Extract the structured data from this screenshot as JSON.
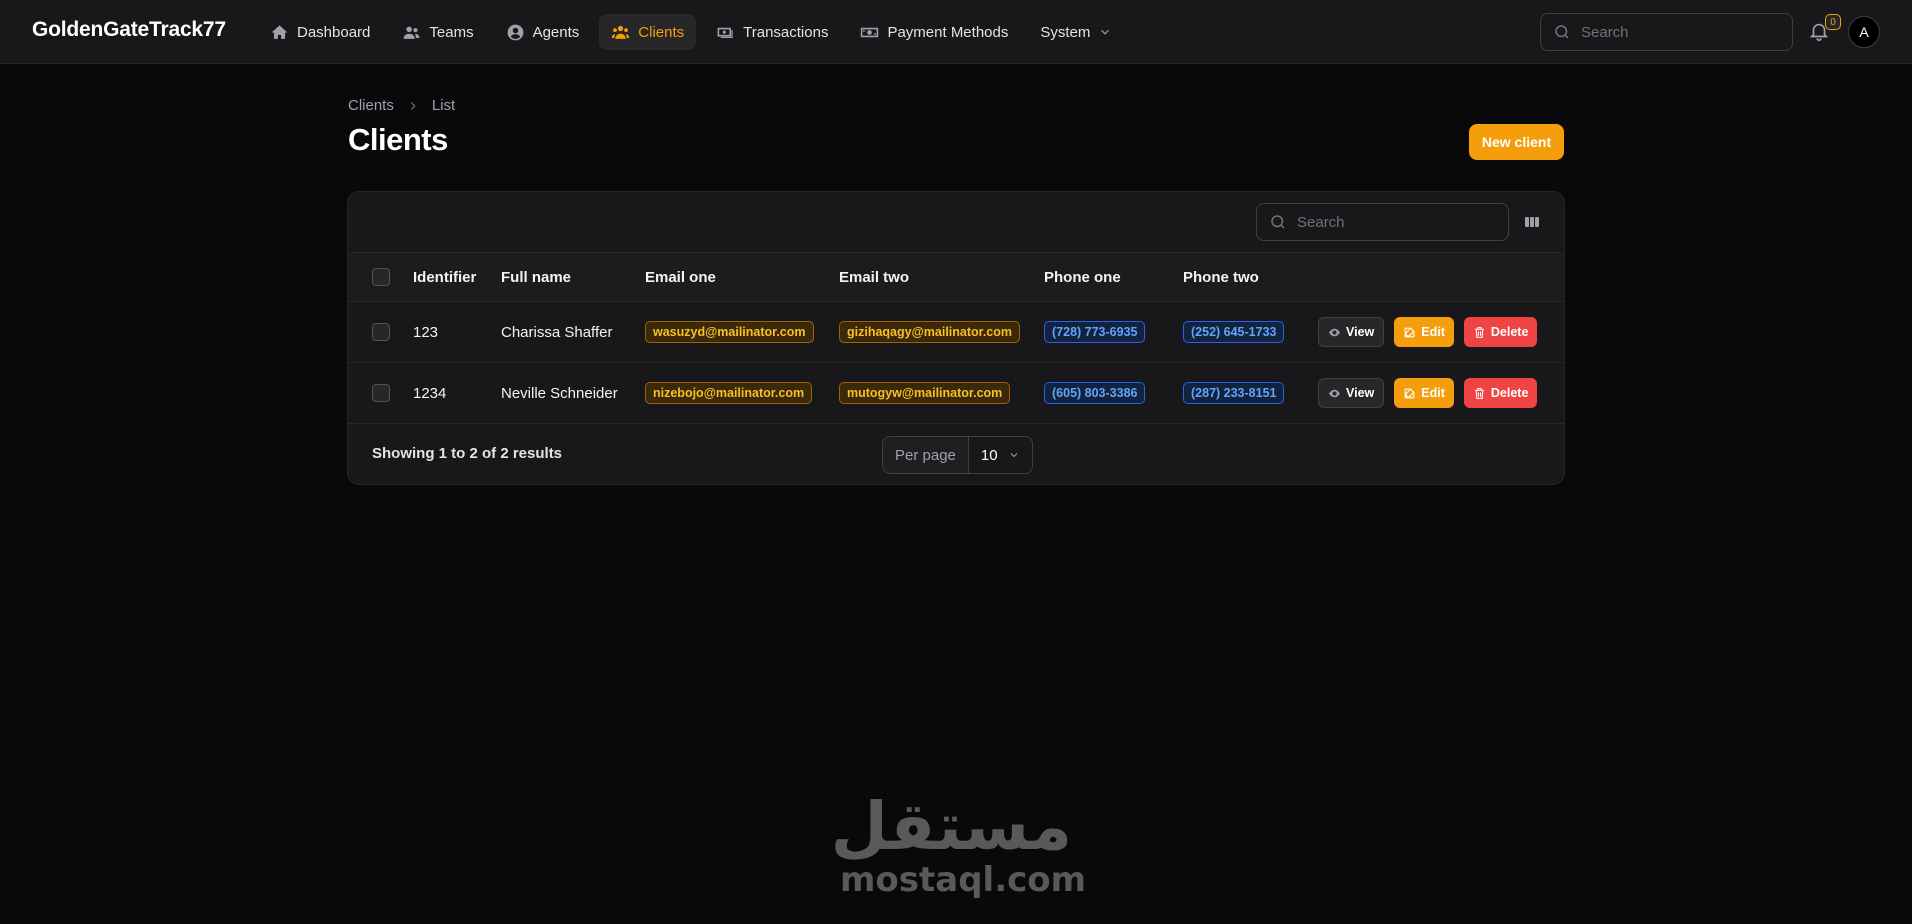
{
  "app": {
    "brand": "GoldenGateTrack77"
  },
  "nav": [
    {
      "label": "Dashboard",
      "icon": "home-icon",
      "active": false
    },
    {
      "label": "Teams",
      "icon": "users-icon",
      "active": false
    },
    {
      "label": "Agents",
      "icon": "user-circle-icon",
      "active": false
    },
    {
      "label": "Clients",
      "icon": "user-group-icon",
      "active": true
    },
    {
      "label": "Transactions",
      "icon": "cash-icon",
      "active": false
    },
    {
      "label": "Payment Methods",
      "icon": "banknotes-icon",
      "active": false
    },
    {
      "label": "System",
      "icon": "chevron-down-icon",
      "active": false
    }
  ],
  "topbar": {
    "search_placeholder": "Search",
    "notification_count": "0",
    "avatar_initial": "A"
  },
  "header": {
    "breadcrumb": [
      "Clients",
      "List"
    ],
    "title": "Clients",
    "new_button": "New client"
  },
  "table": {
    "search_placeholder": "Search",
    "columns": [
      "Identifier",
      "Full name",
      "Email one",
      "Email two",
      "Phone one",
      "Phone two"
    ],
    "rows": [
      {
        "id": "123",
        "name": "Charissa Shaffer",
        "email1": "wasuzyd@mailinator.com",
        "email2": "gizihaqagy@mailinator.com",
        "phone1": "(728) 773-6935",
        "phone2": "(252) 645-1733"
      },
      {
        "id": "1234",
        "name": "Neville Schneider",
        "email1": "nizebojo@mailinator.com",
        "email2": "mutogyw@mailinator.com",
        "phone1": "(605) 803-3386",
        "phone2": "(287) 233-8151"
      }
    ],
    "actions": {
      "view": "View",
      "edit": "Edit",
      "delete": "Delete"
    },
    "footer": {
      "showing": "Showing 1 to 2 of 2 results",
      "per_page_label": "Per page",
      "per_page_value": "10"
    }
  },
  "watermark": {
    "arabic": "مستقل",
    "latin": "mostaql.com"
  },
  "colors": {
    "accent": "#f59e0b",
    "danger": "#ef4444",
    "info": "#60a5fa",
    "background": "#09090b",
    "surface": "#18181b"
  }
}
